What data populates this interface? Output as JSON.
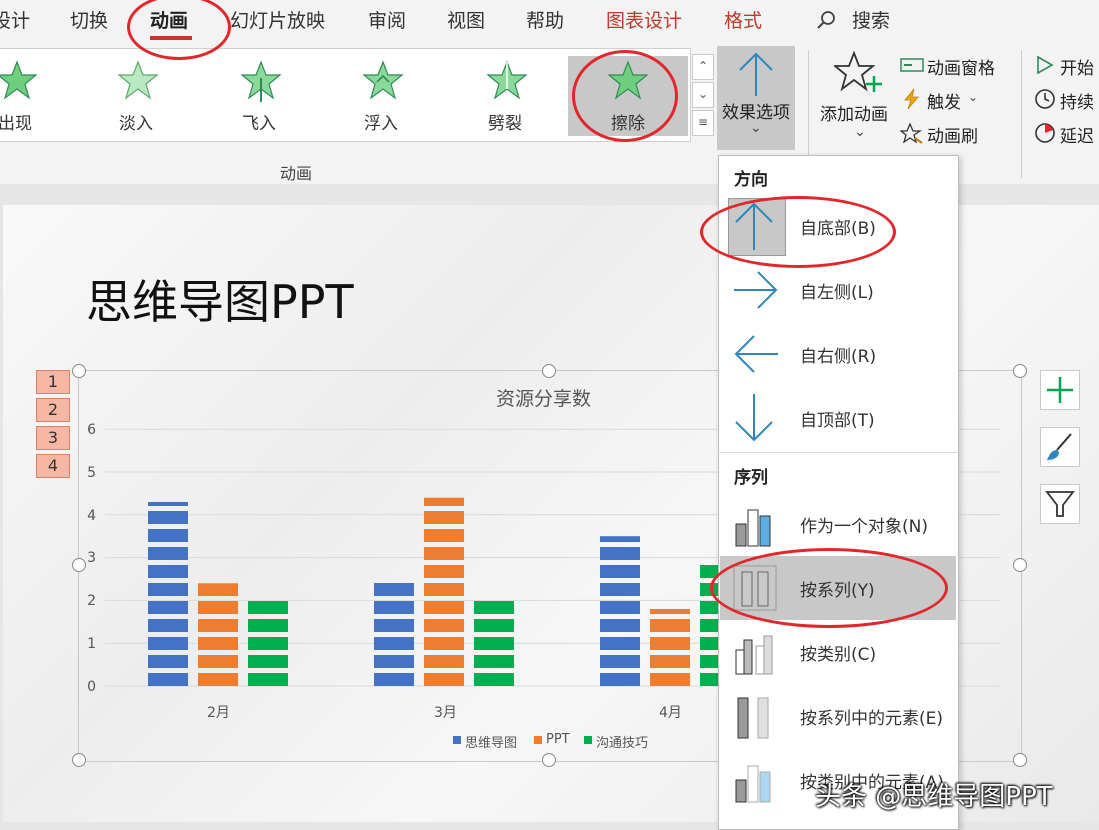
{
  "tabs": [
    {
      "label": "设计",
      "x": -8
    },
    {
      "label": "切换",
      "x": 70
    },
    {
      "label": "动画",
      "x": 150
    },
    {
      "label": "幻灯片放映",
      "x": 230
    },
    {
      "label": "审阅",
      "x": 368
    },
    {
      "label": "视图",
      "x": 447
    },
    {
      "label": "帮助",
      "x": 526
    },
    {
      "label": "图表设计",
      "x": 606
    },
    {
      "label": "格式",
      "x": 724
    }
  ],
  "search_label": "搜索",
  "animations": [
    {
      "label": "出现",
      "x": -30
    },
    {
      "label": "淡入",
      "x": 91
    },
    {
      "label": "飞入",
      "x": 214
    },
    {
      "label": "浮入",
      "x": 336
    },
    {
      "label": "劈裂",
      "x": 460
    },
    {
      "label": "擦除",
      "x": 582
    }
  ],
  "group_label": "动画",
  "effect_options_label": "效果选项",
  "add_animation_label": "添加动画",
  "advanced": {
    "pane": "动画窗格",
    "trigger": "触发",
    "painter": "动画刷"
  },
  "timing": {
    "start": "开始",
    "duration": "持续",
    "delay": "延迟"
  },
  "slide_title": "思维导图PPT",
  "sequence_tags": [
    "1",
    "2",
    "3",
    "4"
  ],
  "dropdown": {
    "direction_header": "方向",
    "directions": [
      {
        "label": "自底部(B)"
      },
      {
        "label": "自左侧(L)"
      },
      {
        "label": "自右侧(R)"
      },
      {
        "label": "自顶部(T)"
      }
    ],
    "sequence_header": "序列",
    "sequences": [
      {
        "label": "作为一个对象(N)"
      },
      {
        "label": "按系列(Y)"
      },
      {
        "label": "按类别(C)"
      },
      {
        "label": "按系列中的元素(E)"
      },
      {
        "label": "按类别中的元素(A)"
      }
    ]
  },
  "chart_data": {
    "type": "bar",
    "title": "资源分享数",
    "categories": [
      "2月",
      "3月",
      "4月"
    ],
    "series": [
      {
        "name": "思维导图",
        "color": "#4472c4",
        "values": [
          4.3,
          2.5,
          3.5
        ]
      },
      {
        "name": "PPT",
        "color": "#ed7d31",
        "values": [
          2.4,
          4.4,
          1.8
        ]
      },
      {
        "name": "沟通技巧",
        "color": "#00b050",
        "values": [
          2.0,
          2.0,
          2.9
        ]
      }
    ],
    "ylim": [
      0,
      6
    ],
    "yticks": [
      "0",
      "1",
      "2",
      "3",
      "4",
      "5",
      "6"
    ],
    "grid": true,
    "legend": "bottom"
  },
  "watermark": "头条 @思维导图PPT",
  "colors": {
    "accent": "#c0392b",
    "highlight_ring": "#e3262b",
    "icon_blue": "#2e86c1"
  }
}
